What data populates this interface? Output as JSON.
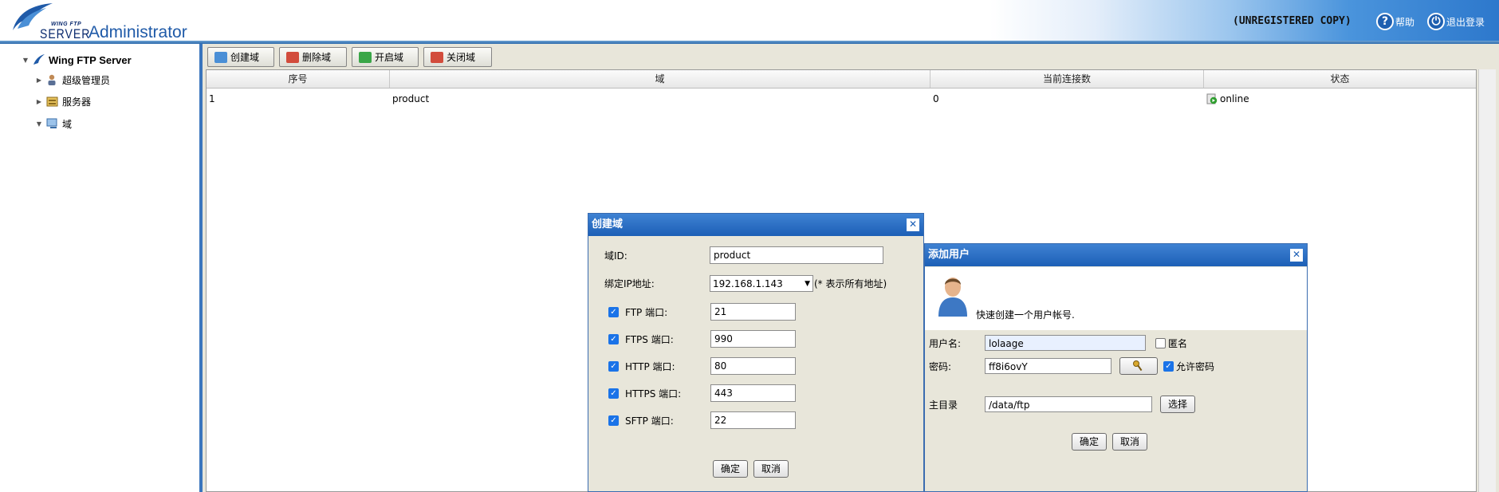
{
  "header": {
    "logo_small": "WING FTP",
    "logo_server": "SERVER",
    "logo_title": "Administrator",
    "unregistered": "(UNREGISTERED COPY)",
    "help": "帮助",
    "logout": "退出登录"
  },
  "tree": {
    "root": "Wing FTP Server",
    "items": [
      {
        "label": "超级管理员",
        "icon": "admin-user-icon"
      },
      {
        "label": "服务器",
        "icon": "server-icon"
      },
      {
        "label": "域",
        "icon": "domain-icon"
      }
    ]
  },
  "toolbar": {
    "create": "创建域",
    "delete": "删除域",
    "start": "开启域",
    "stop": "关闭域"
  },
  "grid": {
    "columns": [
      "序号",
      "域",
      "当前连接数",
      "状态"
    ],
    "rows": [
      {
        "index": "1",
        "domain": "product",
        "connections": "0",
        "status": "online"
      }
    ]
  },
  "create_domain": {
    "title": "创建域",
    "domain_id_label": "域ID:",
    "domain_id_value": "product",
    "bind_ip_label": "绑定IP地址:",
    "bind_ip_value": "192.168.1.143",
    "bind_ip_hint": "(* 表示所有地址)",
    "ports": [
      {
        "label": "FTP 端口:",
        "value": "21",
        "checked": true
      },
      {
        "label": "FTPS 端口:",
        "value": "990",
        "checked": true
      },
      {
        "label": "HTTP 端口:",
        "value": "80",
        "checked": true
      },
      {
        "label": "HTTPS 端口:",
        "value": "443",
        "checked": true
      },
      {
        "label": "SFTP 端口:",
        "value": "22",
        "checked": true
      }
    ],
    "ok": "确定",
    "cancel": "取消"
  },
  "add_user": {
    "title": "添加用户",
    "description": "快速创建一个用户帐号.",
    "username_label": "用户名:",
    "username_value": "lolaage",
    "anonymous_label": "匿名",
    "password_label": "密码:",
    "password_value": "ff8i6ovY",
    "allow_password_label": "允许密码",
    "home_label": "主目录",
    "home_value": "/data/ftp",
    "browse": "选择",
    "ok": "确定",
    "cancel": "取消"
  },
  "colors": {
    "title_bar": "#1c5fb6",
    "panel_bg": "#e8e6da",
    "checkbox": "#1a73e8",
    "online": "#2e9e2e"
  }
}
